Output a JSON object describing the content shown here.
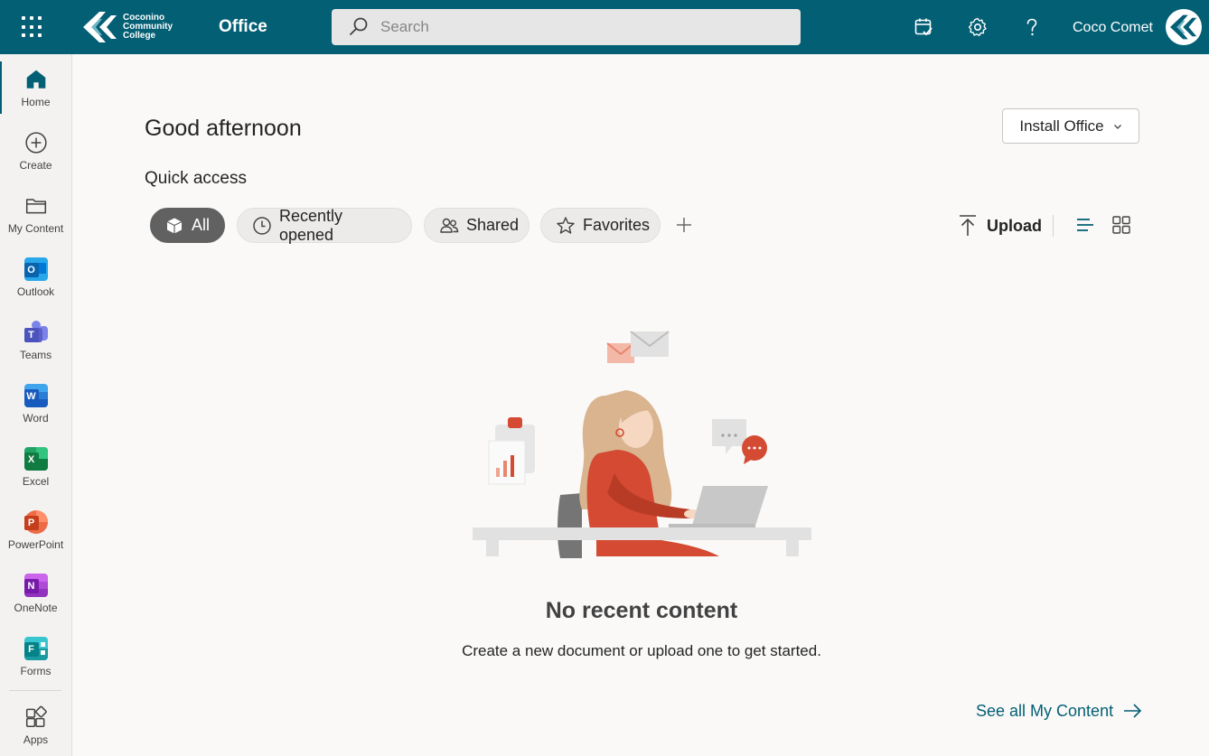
{
  "header": {
    "logo_lines": [
      "Coconino",
      "Community",
      "College"
    ],
    "app_title": "Office",
    "search_placeholder": "Search",
    "user_name": "Coco Comet",
    "icons": [
      "app-launcher-icon",
      "my-day-icon",
      "settings-icon",
      "help-icon"
    ]
  },
  "rail": {
    "items": [
      {
        "label": "Home",
        "icon": "home-icon",
        "active": true
      },
      {
        "label": "Create",
        "icon": "create-icon"
      },
      {
        "label": "My Content",
        "icon": "folder-icon"
      },
      {
        "label": "Outlook",
        "icon": "outlook-icon",
        "color": "#0f6cbd"
      },
      {
        "label": "Teams",
        "icon": "teams-icon",
        "color": "#5b5fc7"
      },
      {
        "label": "Word",
        "icon": "word-icon",
        "color": "#185abd"
      },
      {
        "label": "Excel",
        "icon": "excel-icon",
        "color": "#107c41"
      },
      {
        "label": "PowerPoint",
        "icon": "powerpoint-icon",
        "color": "#c43e1c"
      },
      {
        "label": "OneNote",
        "icon": "onenote-icon",
        "color": "#7719aa"
      },
      {
        "label": "Forms",
        "icon": "forms-icon",
        "color": "#038387"
      },
      {
        "label": "Apps",
        "icon": "apps-icon"
      }
    ]
  },
  "main": {
    "greeting": "Good afternoon",
    "install_label": "Install Office",
    "quick_access_title": "Quick access",
    "filters": [
      {
        "label": "All",
        "icon": "cube-icon",
        "active": true
      },
      {
        "label": "Recently opened",
        "icon": "clock-icon"
      },
      {
        "label": "Shared",
        "icon": "people-icon"
      },
      {
        "label": "Favorites",
        "icon": "star-icon"
      }
    ],
    "upload_label": "Upload",
    "empty_title": "No recent content",
    "empty_subtitle": "Create a new document or upload one to get started.",
    "see_all_label": "See all My Content"
  },
  "colors": {
    "brand": "#035f74",
    "active_pill": "#616161",
    "accent_illustration": "#d44a32"
  }
}
